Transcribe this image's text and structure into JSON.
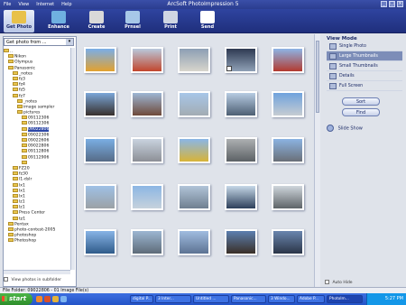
{
  "window": {
    "title": "ArcSoft PhotoImpression 5",
    "menu": [
      "File",
      "View",
      "Internet",
      "Help"
    ]
  },
  "toolbar": {
    "items": [
      {
        "label": "Get Photo",
        "icon": "camera-icon",
        "color": "#e8c14a",
        "active": true
      },
      {
        "label": "Enhance",
        "icon": "enhance-icon",
        "color": "#6fb0e0"
      },
      {
        "label": "Create",
        "icon": "create-icon",
        "color": "#d9d9d9"
      },
      {
        "label": "Prnsel",
        "icon": "prnsel-icon",
        "color": "#a7c8e8"
      },
      {
        "label": "Print",
        "icon": "print-icon",
        "color": "#cfd6e3"
      },
      {
        "label": "Send",
        "icon": "send-icon",
        "color": "#ffffff"
      }
    ]
  },
  "left": {
    "folder_select": "Get photo from ...",
    "tree": [
      {
        "label": "..",
        "indent": 0
      },
      {
        "label": "Nikon",
        "indent": 1
      },
      {
        "label": "Olympus",
        "indent": 1
      },
      {
        "label": "Panasonic",
        "indent": 1
      },
      {
        "label": "_notes",
        "indent": 2
      },
      {
        "label": "fz3",
        "indent": 2
      },
      {
        "label": "fz4",
        "indent": 2
      },
      {
        "label": "fz5",
        "indent": 2
      },
      {
        "label": "fz7",
        "indent": 2
      },
      {
        "label": "_notes",
        "indent": 3
      },
      {
        "label": "image sampler",
        "indent": 3
      },
      {
        "label": "pictures",
        "indent": 3
      },
      {
        "label": "09112306",
        "indent": 4
      },
      {
        "label": "09112306",
        "indent": 4
      },
      {
        "label": "09022806",
        "indent": 4,
        "selected": true
      },
      {
        "label": "09022306",
        "indent": 4
      },
      {
        "label": "09022606",
        "indent": 4
      },
      {
        "label": "09022806",
        "indent": 4
      },
      {
        "label": "09112806",
        "indent": 4
      },
      {
        "label": "09112906",
        "indent": 4
      },
      {
        "label": "",
        "indent": 4
      },
      {
        "label": "FZ20",
        "indent": 2
      },
      {
        "label": "fz30",
        "indent": 2
      },
      {
        "label": "l1-dslr",
        "indent": 2
      },
      {
        "label": "lx1",
        "indent": 2
      },
      {
        "label": "lx1",
        "indent": 2
      },
      {
        "label": "lx1",
        "indent": 2
      },
      {
        "label": "lz1",
        "indent": 2
      },
      {
        "label": "lz1",
        "indent": 2
      },
      {
        "label": "Press Center",
        "indent": 2
      },
      {
        "label": "tz1",
        "indent": 2
      },
      {
        "label": "Pentax",
        "indent": 1
      },
      {
        "label": "photo-contest-2005",
        "indent": 1
      },
      {
        "label": "photoshop",
        "indent": 1
      },
      {
        "label": "Photoshop",
        "indent": 1
      }
    ],
    "subfolder_label": "View photos in subfolder"
  },
  "grid": {
    "rows": 5,
    "cols": 5,
    "thumbnails": [
      {
        "bg": "linear-gradient(#7aaee8,#e2a12f)"
      },
      {
        "bg": "linear-gradient(#b9c9dc,#c2462c)"
      },
      {
        "bg": "linear-gradient(#8d9fb4,#d8d5cc)"
      },
      {
        "bg": "linear-gradient(#2e3a52,#8fa0b6)",
        "mark": true
      },
      {
        "bg": "linear-gradient(#8db4e6,#b33a2f)"
      },
      {
        "bg": "linear-gradient(#7aa6d8,#38302c)"
      },
      {
        "bg": "linear-gradient(#9db6d4,#6f4a3a)"
      },
      {
        "bg": "linear-gradient(#a7c6e8,#a3acb3)"
      },
      {
        "bg": "linear-gradient(#b7cce3,#4d5f73)"
      },
      {
        "bg": "linear-gradient(#6fa2dd,#c6ccd2)"
      },
      {
        "bg": "linear-gradient(#7aaee4,#566b86)"
      },
      {
        "bg": "linear-gradient(#c9d3df,#8c8f96)"
      },
      {
        "bg": "linear-gradient(#8ab6e6,#d8b437)"
      },
      {
        "bg": "linear-gradient(#adb0b2,#5c6165)"
      },
      {
        "bg": "linear-gradient(#8bb3e2,#6a6f78)"
      },
      {
        "bg": "linear-gradient(#9fc1e6,#9ba1a5)"
      },
      {
        "bg": "linear-gradient(#8cb6e4,#c6d2dc)"
      },
      {
        "bg": "linear-gradient(#b1c4d8,#6f7f90)"
      },
      {
        "bg": "linear-gradient(#c6d8e8,#2c3f5a)"
      },
      {
        "bg": "linear-gradient(#cfd6dc,#5e6468)"
      },
      {
        "bg": "linear-gradient(#88b4e6,#2f5b8a)"
      },
      {
        "bg": "linear-gradient(#9cb6d2,#5e6b79)"
      },
      {
        "bg": "linear-gradient(#a0bce0,#5d7393)"
      },
      {
        "bg": "linear-gradient(#5c7fb0,#3a2f27)"
      },
      {
        "bg": "linear-gradient(#6a86ae,#2b3548)"
      }
    ]
  },
  "viewmode": {
    "title": "View Mode",
    "items": [
      {
        "label": "Single Photo",
        "icon": "single-photo-icon"
      },
      {
        "label": "Large Thumbnails",
        "icon": "large-thumbnails-icon",
        "active": true
      },
      {
        "label": "Small Thumbnails",
        "icon": "small-thumbnails-icon"
      },
      {
        "label": "Details",
        "icon": "details-icon"
      },
      {
        "label": "Full Screen",
        "icon": "full-screen-icon"
      }
    ],
    "sort_label": "Sort",
    "find_label": "Find",
    "slideshow_label": "Slide Show",
    "autohide_label": "Auto Hide"
  },
  "status": {
    "text": "File Folder: 09022806 - 01 Image File(s)"
  },
  "taskbar": {
    "start_label": "start",
    "tasks": [
      {
        "label": "digital P..."
      },
      {
        "label": "3 Inter..."
      },
      {
        "label": "Untitled ..."
      },
      {
        "label": "Panasonic..."
      },
      {
        "label": "3 Windo..."
      },
      {
        "label": "Adobe P..."
      },
      {
        "label": "PhotoIm...",
        "active": true
      }
    ],
    "clock": "5:27 PM"
  }
}
